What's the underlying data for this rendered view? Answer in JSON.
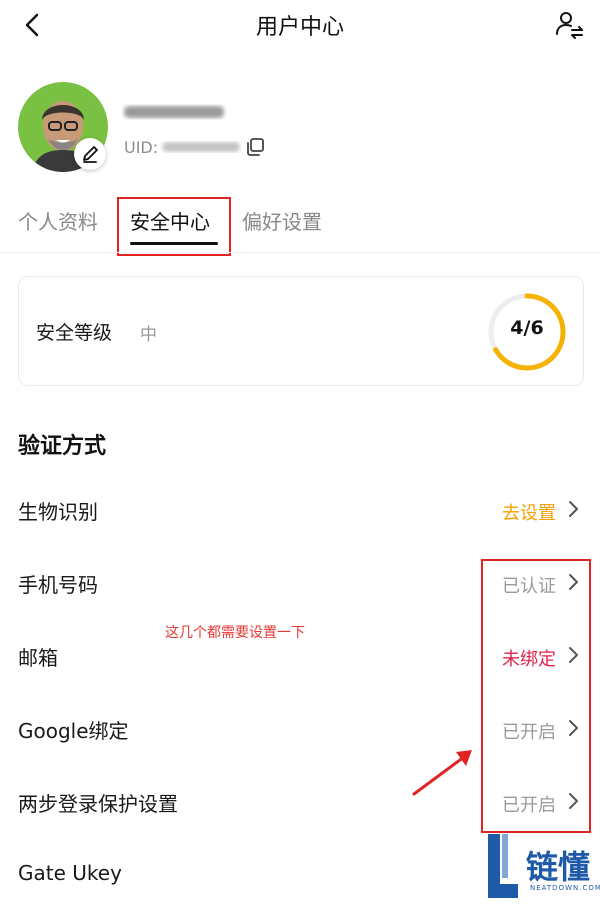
{
  "header": {
    "title": "用户中心",
    "back_icon": "chevron-left-icon",
    "right_icon": "user-switch-icon"
  },
  "profile": {
    "uid_prefix": "UID:",
    "avatar_color": "#7ac143"
  },
  "tabs": [
    {
      "label": "个人资料",
      "active": false
    },
    {
      "label": "安全中心",
      "active": true
    },
    {
      "label": "偏好设置",
      "active": false
    }
  ],
  "security_level": {
    "label": "安全等级",
    "level": "中",
    "score_text": "4/6",
    "score_fraction": 0.667,
    "ring_color": "#f5b300"
  },
  "verify": {
    "section_title": "验证方式",
    "items": [
      {
        "label": "生物识别",
        "status": "去设置",
        "status_color": "#f5a000"
      },
      {
        "label": "手机号码",
        "status": "已认证",
        "status_color": "#9a9a9a"
      },
      {
        "label": "邮箱",
        "status": "未绑定",
        "status_color": "#e0244a"
      },
      {
        "label": "Google绑定",
        "status": "已开启",
        "status_color": "#9a9a9a"
      },
      {
        "label": "两步登录保护设置",
        "status": "已开启",
        "status_color": "#9a9a9a"
      },
      {
        "label": "Gate Ukey",
        "status": "",
        "status_color": "#9a9a9a"
      }
    ]
  },
  "annotation": {
    "note": "这几个都需要设置一下",
    "box_color": "#e02424"
  },
  "watermark": {
    "text": "链懂",
    "sub": "NEATDOWN.COM"
  }
}
